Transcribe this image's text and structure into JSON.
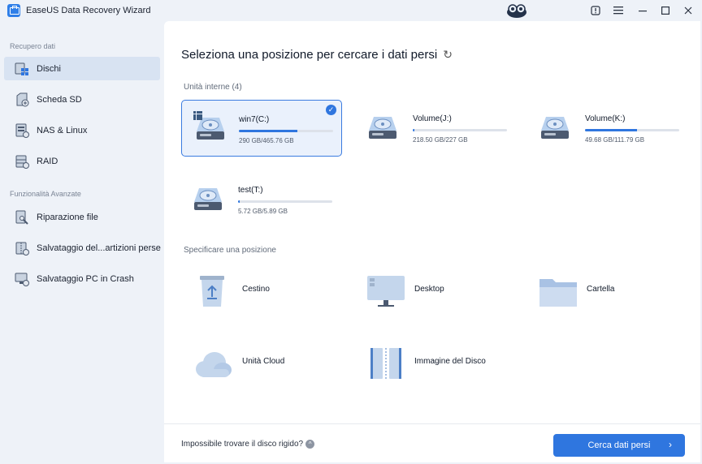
{
  "titlebar": {
    "title": "EaseUS Data Recovery Wizard",
    "buttons": [
      "info",
      "menu",
      "minimize",
      "maximize",
      "close"
    ]
  },
  "sidebar": {
    "section1": "Recupero dati",
    "items1": [
      {
        "label": "Dischi",
        "icon": "disk-grid-icon",
        "active": true
      },
      {
        "label": "Scheda SD",
        "icon": "sd-card-icon"
      },
      {
        "label": "NAS & Linux",
        "icon": "nas-icon"
      },
      {
        "label": "RAID",
        "icon": "raid-icon"
      }
    ],
    "section2": "Funzionalità Avanzate",
    "items2": [
      {
        "label": "Riparazione file",
        "icon": "file-repair-icon"
      },
      {
        "label": "Salvataggio del...artizioni perse",
        "icon": "partition-icon"
      },
      {
        "label": "Salvataggio PC in Crash",
        "icon": "pc-crash-icon"
      }
    ]
  },
  "main": {
    "title": "Seleziona una posizione per cercare i dati persi",
    "internal_label": "Unità interne (4)",
    "disks": [
      {
        "name": "win7(C:)",
        "size": "290 GB/465.76 GB",
        "used_fraction": 0.62,
        "selected": true
      },
      {
        "name": "Volume(J:)",
        "size": "218.50 GB/227 GB",
        "used_fraction": 0.02
      },
      {
        "name": "Volume(K:)",
        "size": "49.68 GB/111.79 GB",
        "used_fraction": 0.55
      },
      {
        "name": "test(T:)",
        "size": "5.72 GB/5.89 GB",
        "used_fraction": 0.02
      }
    ],
    "specify_label": "Specificare una posizione",
    "locations": [
      {
        "label": "Cestino",
        "icon": "recycle-bin-icon"
      },
      {
        "label": "Desktop",
        "icon": "desktop-icon"
      },
      {
        "label": "Cartella",
        "icon": "folder-icon"
      },
      {
        "label": "Unità Cloud",
        "icon": "cloud-icon"
      },
      {
        "label": "Immagine del Disco",
        "icon": "disk-image-icon"
      }
    ]
  },
  "footer": {
    "help_text": "Impossibile trovare il disco rigido?",
    "scan_button": "Cerca dati persi"
  },
  "colors": {
    "accent": "#2f76df",
    "sidebar_bg": "#eef2f8",
    "selected_card": "#eaf1fc"
  }
}
